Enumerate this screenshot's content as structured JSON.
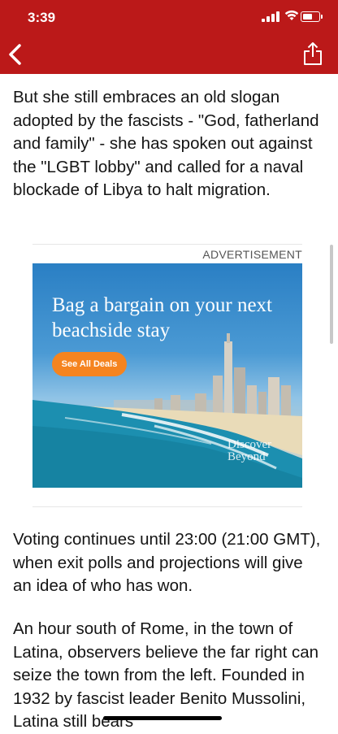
{
  "status_bar": {
    "time": "3:39"
  },
  "nav": {
    "back_icon": "chevron-left-icon",
    "share_icon": "share-icon"
  },
  "article": {
    "paragraphs": [
      "But she still embraces an old slogan adopted by the fascists - \"God, fatherland and family\" - she has spoken out against the \"LGBT lobby\" and called for a naval blockade of Libya to halt migration.",
      "Voting continues until 23:00 (21:00 GMT), when exit polls and projections will give an idea of who has won.",
      "An hour south of Rome, in the town of Latina, observers believe the far right can seize the town from the left. Founded in 1932 by fascist leader Benito Mussolini, Latina still bears"
    ]
  },
  "advertisement": {
    "label": "ADVERTISEMENT",
    "headline": "Bag a bargain on your next beachside stay",
    "cta": "See All Deals",
    "brand_line1": "Discover",
    "brand_line2": "Beyond"
  },
  "colors": {
    "header": "#bb1919",
    "cta": "#f5841f",
    "text": "#141414"
  }
}
